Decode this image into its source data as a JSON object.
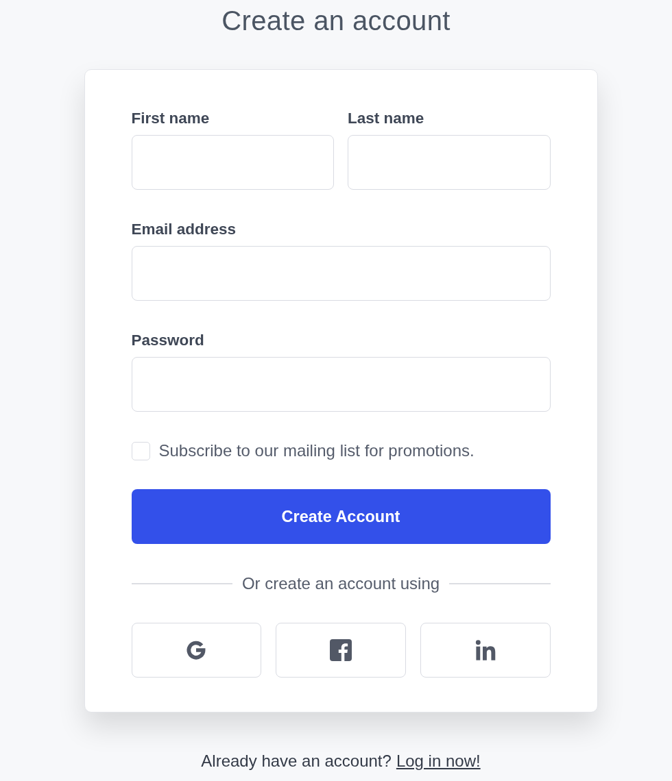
{
  "title": "Create an account",
  "field_rows": [
    {
      "fields": [
        {
          "label": "First name"
        },
        {
          "label": "Last name"
        }
      ]
    },
    {
      "fields": [
        {
          "label": "Email address"
        }
      ]
    },
    {
      "fields": [
        {
          "label": "Password"
        }
      ]
    }
  ],
  "subscribe": {
    "label": "Subscribe to our mailing list for promotions.",
    "checked": false
  },
  "submit_button": "Create Account",
  "divider_text": "Or create an account using",
  "social_buttons": [
    {
      "kind": "google"
    },
    {
      "kind": "facebook"
    },
    {
      "kind": "linkedin"
    }
  ],
  "footer": {
    "text": "Already have an account?",
    "link": "Log in now!"
  }
}
